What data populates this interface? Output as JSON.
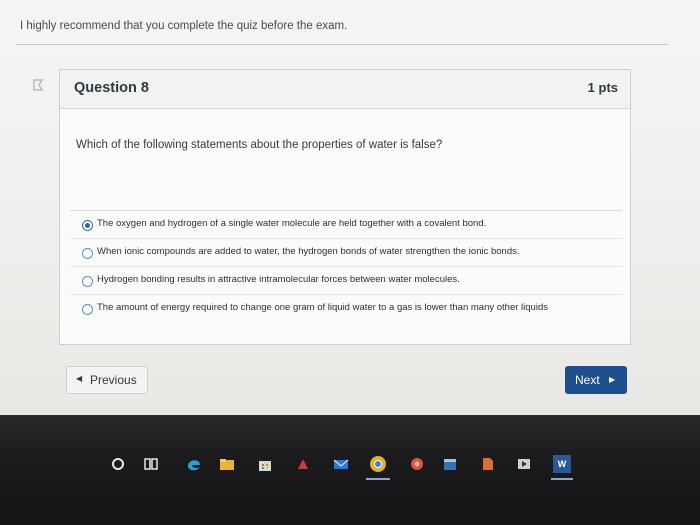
{
  "instruction": "I highly recommend that you complete the quiz before the exam.",
  "question": {
    "title": "Question 8",
    "points": "1 pts",
    "text": "Which of the following statements about the properties of water is false?",
    "answers": [
      {
        "label": "The oxygen and hydrogen of a single water molecule are held together with a covalent bond.",
        "selected": true
      },
      {
        "label": "When ionic compounds are added to water, the hydrogen bonds of water strengthen the ionic bonds.",
        "selected": false
      },
      {
        "label": "Hydrogen bonding results in attractive intramolecular forces between water molecules.",
        "selected": false
      },
      {
        "label": "The amount of energy required to change one gram of liquid water to a gas is lower than many other liquids",
        "selected": false
      }
    ]
  },
  "nav": {
    "previous_label": "Previous",
    "next_label": "Next"
  },
  "taskbar": {
    "icons": [
      "start-circle-icon",
      "task-view-icon",
      "edge-icon",
      "file-explorer-icon",
      "store-icon",
      "app-icon",
      "mail-icon",
      "chrome-icon",
      "camera-app-icon",
      "calendar-icon",
      "file-icon",
      "media-icon",
      "word-icon"
    ],
    "word_label": "W"
  },
  "colors": {
    "accent": "#1f4e8c",
    "radio": "#2c6ab0"
  }
}
